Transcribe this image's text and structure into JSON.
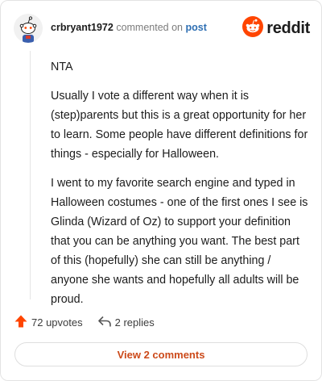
{
  "comment": {
    "author": "crbryant1972",
    "action_text": "commented on",
    "target_link": "post",
    "paragraphs": [
      "NTA",
      "Usually I vote a different way when it is (step)parents but this is a great opportunity for her to learn. Some people have different definitions for things - especially for Halloween.",
      "I went to my favorite search engine and typed in Halloween costumes - one of the first ones I see is Glinda (Wizard of Oz) to support your definition that you can be anything you want. The best part of this (hopefully) she can still be anything / anyone she wants and hopefully all adults will be proud."
    ]
  },
  "brand": {
    "wordmark": "reddit",
    "color": "#ff4500"
  },
  "stats": {
    "upvotes": "72 upvotes",
    "replies": "2 replies"
  },
  "footer": {
    "view_comments_label": "View 2 comments"
  },
  "icons": {
    "avatar": "snoo-avatar-icon",
    "logo": "reddit-logo-icon",
    "upvote": "upvote-arrow-icon",
    "reply": "reply-arrow-icon"
  },
  "colors": {
    "accent": "#ff4500",
    "link": "#2e6fb3",
    "button_text": "#cc4a1a"
  }
}
